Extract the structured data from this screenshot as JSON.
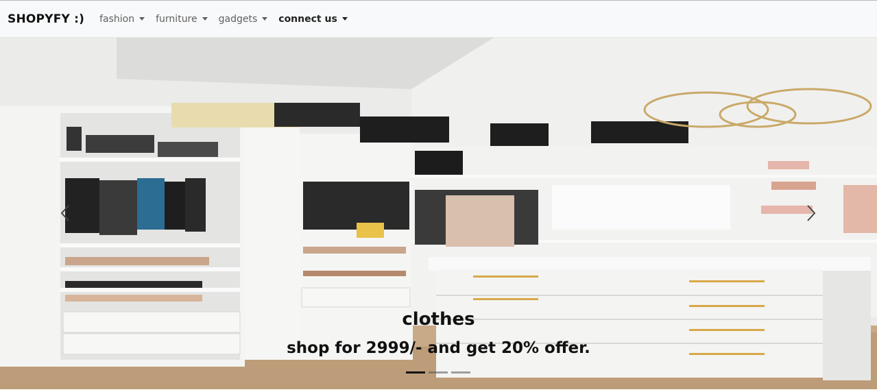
{
  "navbar": {
    "brand": "SHOPYFY :)",
    "items": [
      {
        "label": "fashion"
      },
      {
        "label": "furniture"
      },
      {
        "label": "gadgets"
      },
      {
        "label": "connect us"
      }
    ]
  },
  "carousel": {
    "caption_title": "clothes",
    "caption_text": "shop for 2999/- and get 20% offer.",
    "active_slide": 1,
    "slide_count": 3
  }
}
